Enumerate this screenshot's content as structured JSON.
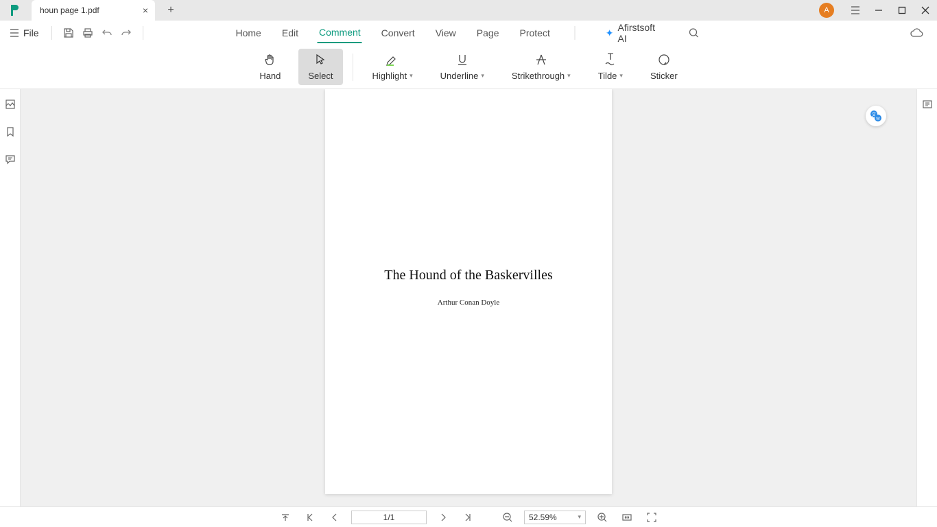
{
  "titlebar": {
    "tab_title": "houn page 1.pdf",
    "avatar_letter": "A"
  },
  "quickbar": {
    "file_label": "File"
  },
  "menubar": {
    "items": [
      "Home",
      "Edit",
      "Comment",
      "Convert",
      "View",
      "Page",
      "Protect"
    ],
    "active_index": 2,
    "ai_label": "Afirstsoft AI"
  },
  "toolbar": {
    "hand": "Hand",
    "select": "Select",
    "highlight": "Highlight",
    "underline": "Underline",
    "strikethrough": "Strikethrough",
    "tilde": "Tilde",
    "sticker": "Sticker"
  },
  "document": {
    "title": "The Hound of the Baskervilles",
    "author": "Arthur Conan Doyle"
  },
  "statusbar": {
    "page_indicator": "1/1",
    "zoom": "52.59%"
  }
}
